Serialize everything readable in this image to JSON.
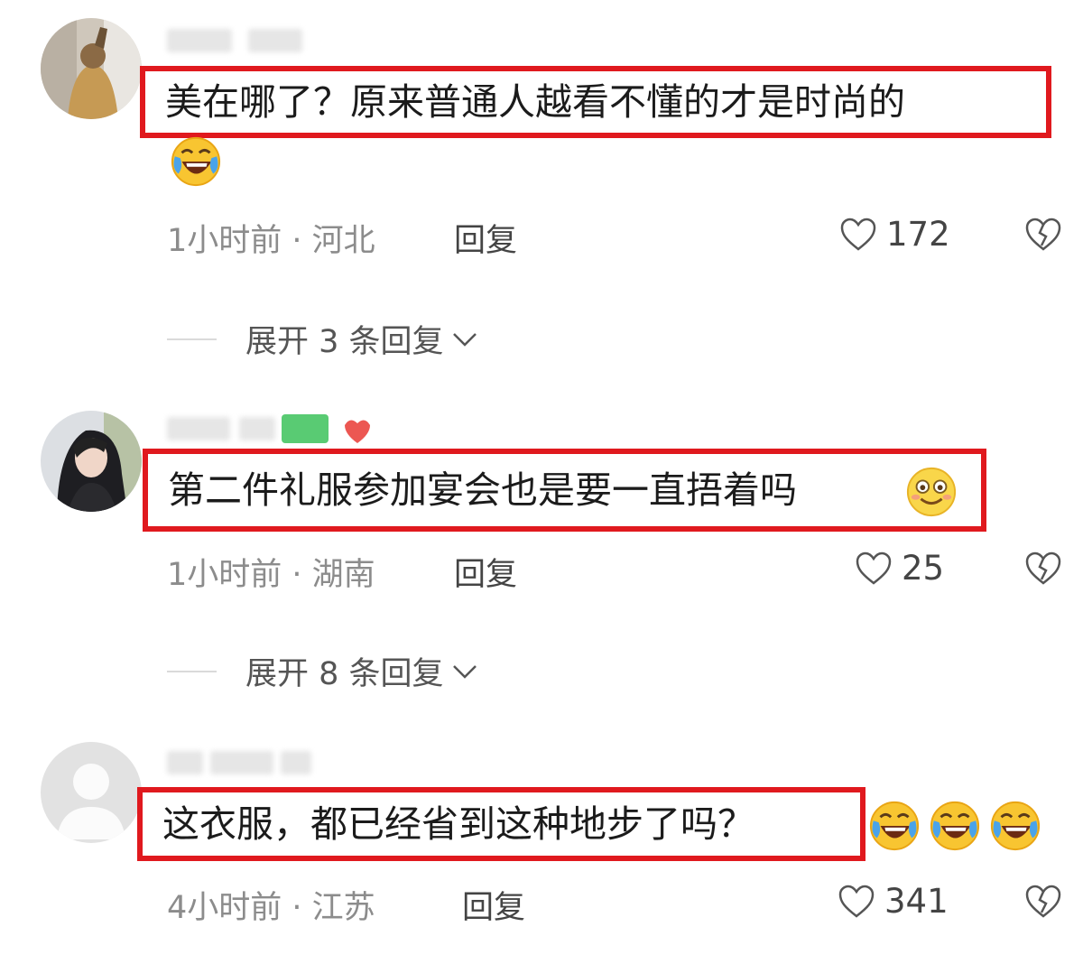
{
  "comments": [
    {
      "text": "美在哪了？原来普通人越看不懂的才是时尚的",
      "emoji": [
        "laugh-cry"
      ],
      "time": "1小时前",
      "location": "河北",
      "reply_label": "回复",
      "likes": "172",
      "expand_label": "展开 3 条回复"
    },
    {
      "text": "第二件礼服参加宴会也是要一直捂着吗",
      "emoji": [
        "smile"
      ],
      "time": "1小时前",
      "location": "湖南",
      "reply_label": "回复",
      "likes": "25",
      "expand_label": "展开 8 条回复"
    },
    {
      "text": "这衣服，都已经省到这种地步了吗？",
      "emoji": [
        "laugh-cry",
        "laugh-cry",
        "laugh-cry"
      ],
      "time": "4小时前",
      "location": "江苏",
      "reply_label": "回复",
      "likes": "341"
    }
  ],
  "separator": " · ",
  "colors": {
    "highlight_border": "#e0191e",
    "meta_text": "#8c8c8c",
    "background": "#ffffff"
  },
  "icons": {
    "like": "heart-outline-icon",
    "dislike": "broken-heart-icon",
    "expand": "chevron-down-icon"
  }
}
